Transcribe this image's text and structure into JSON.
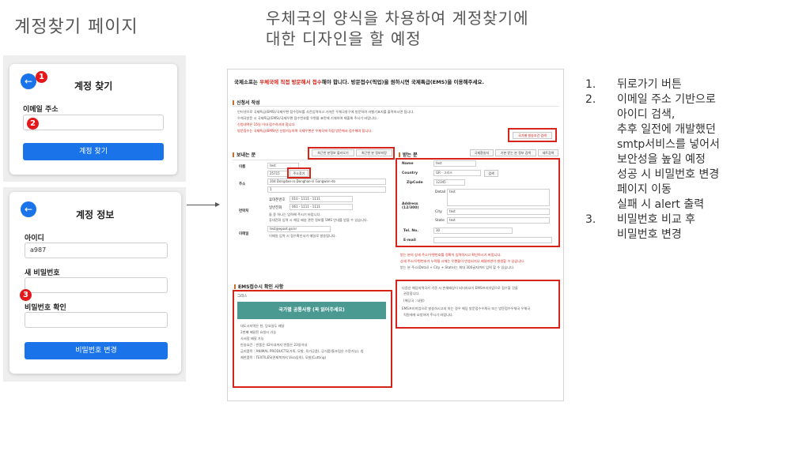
{
  "slide": {
    "title": "계정찾기 페이지",
    "center_caption": "우체국의 양식을 차용하여 계정찾기에 대한 디자인을 할 예정"
  },
  "find_account_card": {
    "back_icon": "←",
    "heading": "계정 찾기",
    "email_label": "이메일 주소",
    "email_value": "",
    "submit_label": "계정 찾기",
    "badges": [
      "1",
      "2"
    ]
  },
  "account_info_card": {
    "back_icon": "←",
    "heading": "계정 정보",
    "id_label": "아이디",
    "id_value": "a987",
    "new_pw_label": "새 비밀번호",
    "new_pw_value": "",
    "confirm_pw_label": "비밀번호 확인",
    "confirm_pw_value": "",
    "submit_label": "비밀번호 변경",
    "badge": "3"
  },
  "postal_form": {
    "notice_prefix": "국제소포는 ",
    "notice_red": "우체국에 직접 방문해서 접수",
    "notice_suffix": "해야 합니다. 방문접수(픽업)을 원하시면 국제특급(EMS)을 이용해주세요.",
    "section_apply": "신청서 작성",
    "apply_lines": [
      "인터넷으로 국제특급(EMS)/국제우편 접수정보를 사전입력하고 가까운 우체국창구에 방문하여 라벨기표지를 출력하시면 됩니다.",
      "우체국방문 시 국제특급(EMS)/국제우편 접수번호를 우편물 표면에 기재하여 제출해 주시기 바랍니다.",
      "신청내역은 15일 이내 접수하셔야 합니다.",
      "방문접수는 국제특급(EMS)만 신청가능하며 국제우편은 우체국에 직접 방문해서 접수해야 합니다."
    ],
    "collect_button": "국가별 발송조건 검색",
    "section_sender": "보내는 분",
    "sender_buttons": [
      "최근한 분정보 불러오기",
      "최근한 분 정보저장"
    ],
    "sender_rows": [
      {
        "label": "이름",
        "value": "test"
      },
      {
        "label": "주소",
        "value": "25715"
      },
      {
        "label": "연락처",
        "value": "010 - 1111 - 1111"
      },
      {
        "label": "이메일",
        "value": "test@epost.go.kr"
      }
    ],
    "addr_search_btn": "주소찾기",
    "address_line": "104 Dongdae-ro Donghae-si Gangwon-do",
    "address_line2": "1",
    "phone_labels": [
      "휴대폰번호",
      "일반전화"
    ],
    "phone_values": [
      "010 - 1111 - 1111",
      "061 - 1111 - 1111"
    ],
    "phone_note1": "둘 중 하나는 입력해 주시기 바랍니다.",
    "phone_note2": "휴대전화 입력 시 해당 배송 관련 정보를 SMS 안내를 받을 수 있습니다.",
    "email_note": "이메일 입력 시 접수확인서가 메일로 발송됩니다.",
    "section_receiver": "받는 분",
    "receiver_buttons": [
      "국제환송지",
      "기본 받는 분 정보 검색",
      "세트검색"
    ],
    "receiver_rows": [
      {
        "label": "Name",
        "value": "test"
      },
      {
        "label": "Country",
        "value": "GR - 그리스"
      },
      {
        "label": "ZipCode",
        "value": "12345"
      },
      {
        "label": "Address (12/300)",
        "value": "test"
      },
      {
        "label": "Tel. No.",
        "value": "30"
      },
      {
        "label": "E-mail",
        "value": ""
      }
    ],
    "country_search_btn": "검색",
    "address_sublabels": [
      "Detail",
      "City",
      "State"
    ],
    "address_subvalues": [
      "test",
      "test",
      "test"
    ],
    "receiver_notes": [
      "받는 분의 상세 주소/우편번호를 정확히 입력하시고 확인하시기 바랍니다.",
      "상세 주소/우편번호가 누락될 시에는 우편물이 반송되거나 배달지연이 발생할 수 있습니다.",
      "받는 분 주소(Detail + City + State)는 최대 300글자까지 입력 할 수 있습니다."
    ],
    "section_ems": "EMS접수시 확인 사항",
    "ems_country": "그리스",
    "ems_banner": "국가별 공통사항 (꼭 읽어주세요)",
    "ems_lines": [
      "대도시지역은 한, 당요일도 배달",
      "2번째 배달된 요청시 가능",
      "사서함 배달 가능",
      "반송요건 : 반품은 42이내까지 반품은 23일이내",
      "금지품목 : ANIMAL PRODUCTS(가죽, 모발, 육가공품), 공식품(통조림은 수량가능), 칩",
      "제한품목 : TEXTILES(면제복까지 Visa동의), 모발(Cutting)"
    ],
    "ems_right_lines": [
      "다음은 해당지역국가 기준 시 손해배상이 되더라요이 EMS프리미엄으로 접수할 것을",
      "권장합니다.",
      "(해당국 : 네팔)",
      "EMS프리미엄으로 발송하시고자 하는 경우 해당 방문접수우체국 또는 방문접수우체국 우체국",
      "직원에게 요청하여 주시기 바랍니다."
    ]
  },
  "notes": [
    {
      "num": "1.",
      "lines": [
        "뒤로가기 버튼"
      ]
    },
    {
      "num": "2.",
      "lines": [
        "이메일 주소 기반으로",
        "아이디 검색,",
        "추후 일전에 개발했던",
        "smtp서비스를 넣어서",
        "보안성을 높일 예정",
        "성공 시 비밀번호 변경",
        "페이지 이동",
        "실패 시 alert 출력"
      ]
    },
    {
      "num": "3.",
      "lines": [
        "비밀번호 비교 후",
        "비밀번호 변경"
      ]
    }
  ],
  "colors": {
    "primary": "#1a73e8",
    "badge_red": "#e4171b",
    "highlight_red": "#d8231b",
    "teal_banner": "#4a9a92"
  },
  "icons": [
    "back-arrow-icon",
    "right-arrow-icon"
  ]
}
